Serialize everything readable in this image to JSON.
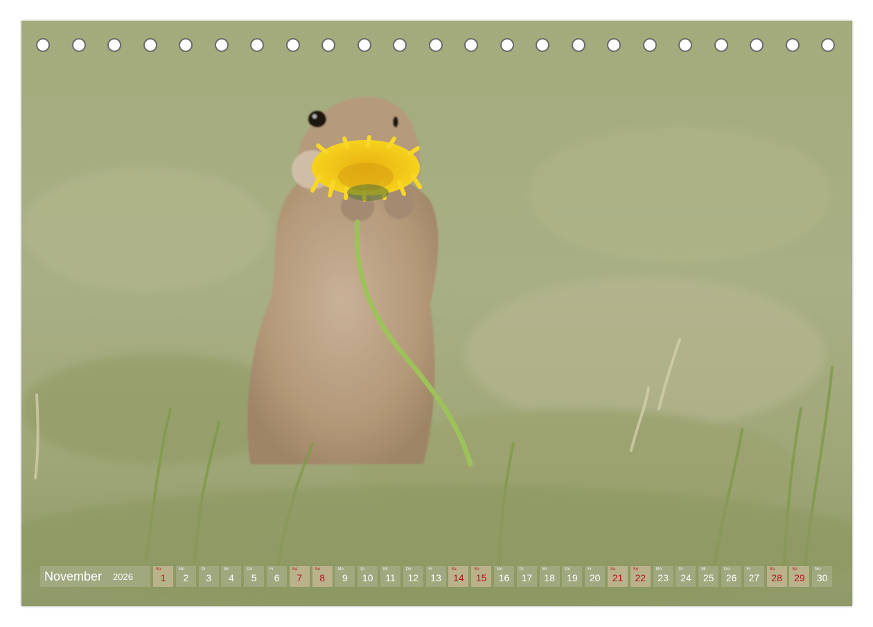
{
  "calendar": {
    "month": "November",
    "year": "2026",
    "days": [
      {
        "wd": "So",
        "num": "1",
        "sun": true
      },
      {
        "wd": "Mo",
        "num": "2",
        "sun": false
      },
      {
        "wd": "Di",
        "num": "3",
        "sun": false
      },
      {
        "wd": "Mi",
        "num": "4",
        "sun": false
      },
      {
        "wd": "Do",
        "num": "5",
        "sun": false
      },
      {
        "wd": "Fr",
        "num": "6",
        "sun": false
      },
      {
        "wd": "Sa",
        "num": "7",
        "sun": true
      },
      {
        "wd": "So",
        "num": "8",
        "sun": true
      },
      {
        "wd": "Mo",
        "num": "9",
        "sun": false
      },
      {
        "wd": "Di",
        "num": "10",
        "sun": false
      },
      {
        "wd": "Mi",
        "num": "11",
        "sun": false
      },
      {
        "wd": "Do",
        "num": "12",
        "sun": false
      },
      {
        "wd": "Fr",
        "num": "13",
        "sun": false
      },
      {
        "wd": "Sa",
        "num": "14",
        "sun": true
      },
      {
        "wd": "So",
        "num": "15",
        "sun": true
      },
      {
        "wd": "Mo",
        "num": "16",
        "sun": false
      },
      {
        "wd": "Di",
        "num": "17",
        "sun": false
      },
      {
        "wd": "Mi",
        "num": "18",
        "sun": false
      },
      {
        "wd": "Do",
        "num": "19",
        "sun": false
      },
      {
        "wd": "Fr",
        "num": "20",
        "sun": false
      },
      {
        "wd": "Sa",
        "num": "21",
        "sun": true
      },
      {
        "wd": "So",
        "num": "22",
        "sun": true
      },
      {
        "wd": "Mo",
        "num": "23",
        "sun": false
      },
      {
        "wd": "Di",
        "num": "24",
        "sun": false
      },
      {
        "wd": "Mi",
        "num": "25",
        "sun": false
      },
      {
        "wd": "Do",
        "num": "26",
        "sun": false
      },
      {
        "wd": "Fr",
        "num": "27",
        "sun": false
      },
      {
        "wd": "Sa",
        "num": "28",
        "sun": true
      },
      {
        "wd": "So",
        "num": "29",
        "sun": true
      },
      {
        "wd": "Mo",
        "num": "30",
        "sun": false
      }
    ]
  },
  "binding": {
    "hole_count": 23
  },
  "colors": {
    "weekend_red": "#b01818",
    "meadow_green": "#a4ad80",
    "dandelion_yellow": "#f2c919"
  }
}
